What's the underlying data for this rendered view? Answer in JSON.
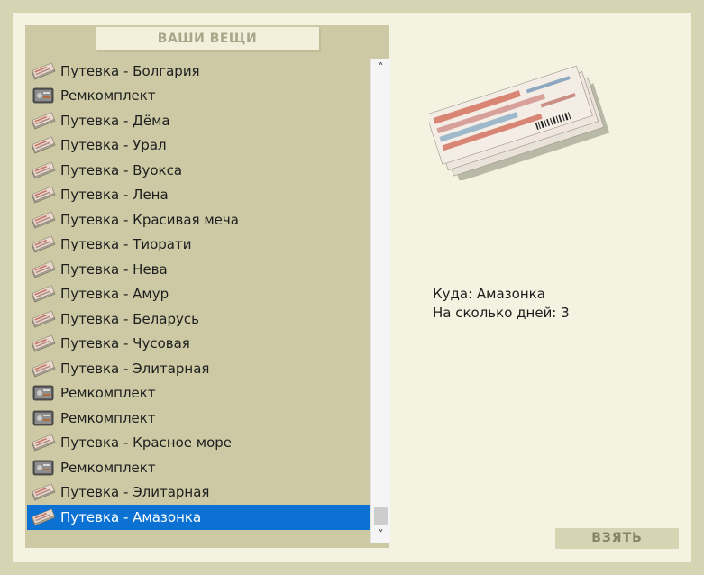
{
  "panel": {
    "title": "ВАШИ ВЕЩИ"
  },
  "items": [
    {
      "label": "Путевка - Болгария",
      "icon": "ticket-icon",
      "selected": false
    },
    {
      "label": "Ремкомплект",
      "icon": "toolkit-icon",
      "selected": false
    },
    {
      "label": "Путевка - Дёма",
      "icon": "ticket-icon",
      "selected": false
    },
    {
      "label": "Путевка - Урал",
      "icon": "ticket-icon",
      "selected": false
    },
    {
      "label": "Путевка - Вуокса",
      "icon": "ticket-icon",
      "selected": false
    },
    {
      "label": "Путевка - Лена",
      "icon": "ticket-icon",
      "selected": false
    },
    {
      "label": "Путевка - Красивая меча",
      "icon": "ticket-icon",
      "selected": false
    },
    {
      "label": "Путевка - Тиорати",
      "icon": "ticket-icon",
      "selected": false
    },
    {
      "label": "Путевка - Нева",
      "icon": "ticket-icon",
      "selected": false
    },
    {
      "label": "Путевка - Амур",
      "icon": "ticket-icon",
      "selected": false
    },
    {
      "label": "Путевка - Беларусь",
      "icon": "ticket-icon",
      "selected": false
    },
    {
      "label": "Путевка - Чусовая",
      "icon": "ticket-icon",
      "selected": false
    },
    {
      "label": "Путевка - Элитарная",
      "icon": "ticket-icon",
      "selected": false
    },
    {
      "label": "Ремкомплект",
      "icon": "toolkit-icon",
      "selected": false
    },
    {
      "label": "Ремкомплект",
      "icon": "toolkit-icon",
      "selected": false
    },
    {
      "label": "Путевка - Красное море",
      "icon": "ticket-icon",
      "selected": false
    },
    {
      "label": "Ремкомплект",
      "icon": "toolkit-icon",
      "selected": false
    },
    {
      "label": "Путевка - Элитарная",
      "icon": "ticket-icon",
      "selected": false
    },
    {
      "label": "Путевка - Амазонка",
      "icon": "ticket-icon",
      "selected": true
    }
  ],
  "scrollbar": {
    "up_glyph": "˄",
    "down_glyph": "˅"
  },
  "detail": {
    "image_icon": "ticket-stack-image",
    "destination_line": "Куда: Амазонка",
    "days_line": "На сколько дней: 3"
  },
  "take_button": {
    "label": "ВЗЯТЬ"
  },
  "colors": {
    "background": "#d6d4b2",
    "frame": "#f4f3e2",
    "list_panel": "#ccc9a4",
    "selection": "#0b72d4",
    "button_text": "#868468"
  }
}
